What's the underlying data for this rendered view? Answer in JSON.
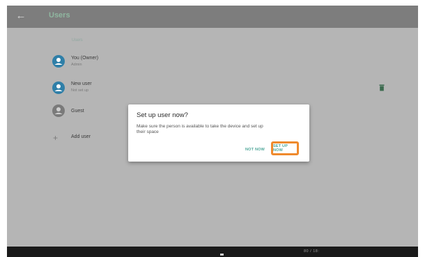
{
  "appbar": {
    "title": "Users"
  },
  "section": {
    "label": "Users"
  },
  "users": [
    {
      "name": "You (Owner)",
      "subtitle": "Admin",
      "avatar_color": "#2f7fa8"
    },
    {
      "name": "New user",
      "subtitle": "Not set up",
      "avatar_color": "#2f7fa8"
    },
    {
      "name": "Guest",
      "subtitle": "",
      "avatar_color": "#7a7a7a"
    }
  ],
  "add_user": {
    "label": "Add user"
  },
  "dialog": {
    "title": "Set up user now?",
    "body": "Make sure the person is available to take the device and set up their space",
    "buttons": {
      "not_now": "NOT NOW",
      "set_up_now": "SET UP NOW"
    }
  },
  "navbar": {
    "status": "80 / 18:"
  },
  "colors": {
    "accent": "#4da698",
    "highlight": "#ef8a2d",
    "scrim": "#b5b5b5",
    "appbar": "#7d7d7d"
  },
  "icons": [
    "back-arrow-icon",
    "user-avatar-icon",
    "guest-avatar-icon",
    "trash-icon",
    "plus-icon",
    "chevron-right-icon"
  ]
}
